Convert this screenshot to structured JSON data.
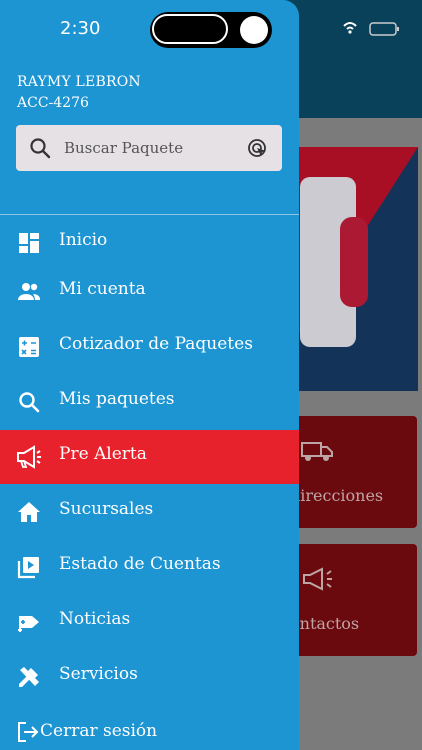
{
  "status_bar": {
    "time": "2:30"
  },
  "user": {
    "name": "RAYMY LEBRON",
    "account": "ACC-4276"
  },
  "search": {
    "placeholder": "Buscar Paquete",
    "value": ""
  },
  "menu": [
    {
      "label": "Inicio",
      "icon": "dashboard-icon",
      "active": false
    },
    {
      "label": "Mi cuenta",
      "icon": "people-icon",
      "active": false
    },
    {
      "label": "Cotizador de Paquetes",
      "icon": "calculator-icon",
      "active": false
    },
    {
      "label": "Mis paquetes",
      "icon": "search-icon",
      "active": false
    },
    {
      "label": "Pre Alerta",
      "icon": "megaphone-icon",
      "active": true
    },
    {
      "label": "Sucursales",
      "icon": "home-icon",
      "active": false
    },
    {
      "label": "Estado de Cuentas",
      "icon": "video-library-icon",
      "active": false
    },
    {
      "label": "Noticias",
      "icon": "news-tag-icon",
      "active": false
    },
    {
      "label": "Servicios",
      "icon": "tools-icon",
      "active": false
    }
  ],
  "logout": {
    "label": "Cerrar sesión",
    "icon": "logout-icon"
  },
  "background_cards": [
    {
      "label": "direcciones",
      "icon": "truck-icon"
    },
    {
      "label": "ontactos",
      "icon": "megaphone-icon"
    }
  ],
  "colors": {
    "drawer": "#1d95d3",
    "active_item": "#e8222d",
    "header": "#0b4a68",
    "card": "#7a0c10"
  }
}
